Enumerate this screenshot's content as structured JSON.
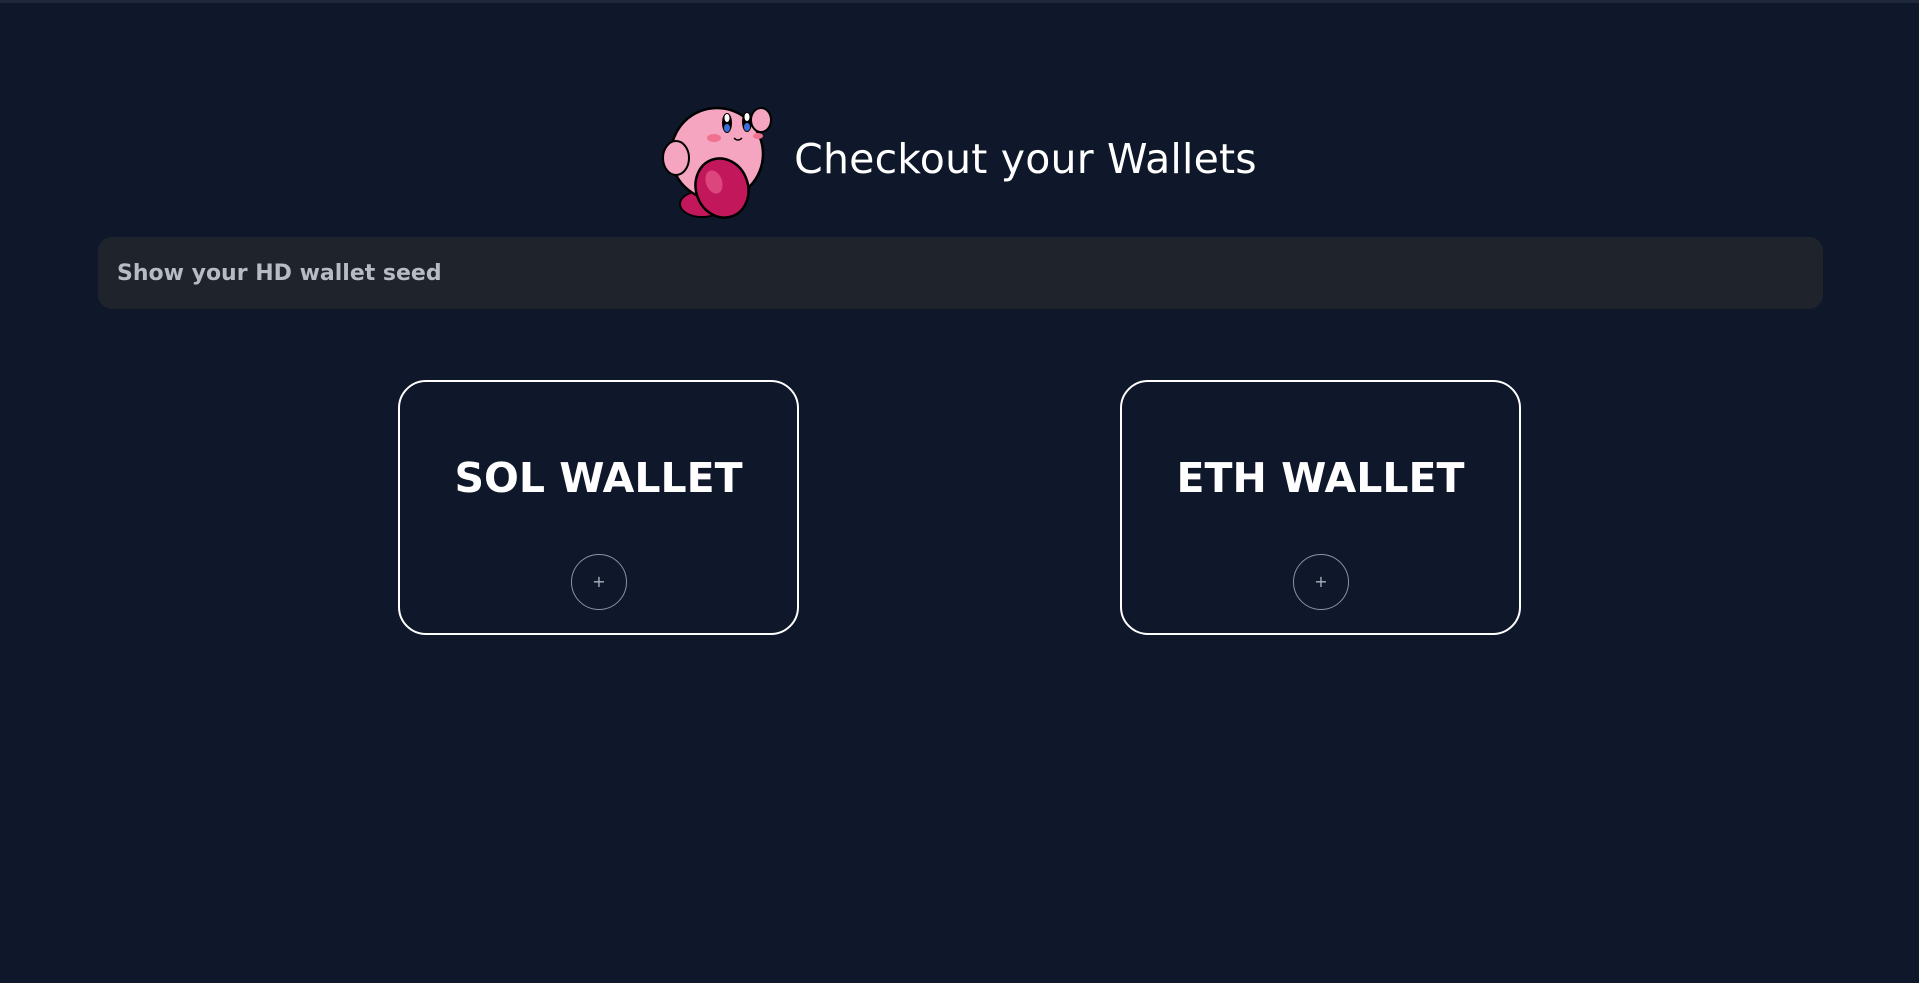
{
  "header": {
    "title": "Checkout your Wallets",
    "mascot_icon": "kirby-mascot-icon"
  },
  "seed": {
    "label": "Show your HD wallet seed"
  },
  "wallets": [
    {
      "label": "SOL WALLET",
      "add_label": "+"
    },
    {
      "label": "ETH WALLET",
      "add_label": "+"
    }
  ],
  "colors": {
    "background": "#0f172a",
    "seed_bar": "#1f242c",
    "text": "#ffffff",
    "muted_text": "#b6bbc4",
    "mascot_pink": "#f4a3bf",
    "mascot_red": "#c2185b"
  }
}
